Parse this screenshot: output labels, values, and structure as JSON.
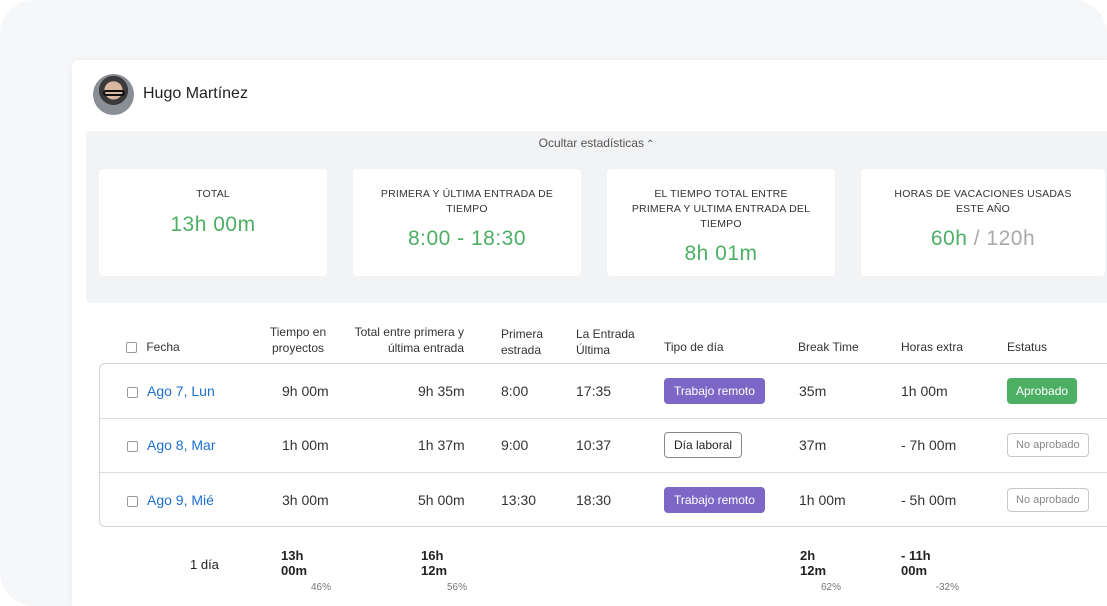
{
  "user": {
    "name": "Hugo Martínez"
  },
  "stats": {
    "toggle_label": "Ocultar estadísticas",
    "cards": [
      {
        "label": "TOTAL",
        "value": "13h 00m"
      },
      {
        "label": "PRIMERA Y ÚLTIMA ENTRADA DE TIEMPO",
        "value": "8:00 - 18:30"
      },
      {
        "label": "EL TIEMPO TOTAL ENTRE PRIMERA Y ULTIMA ENTRADA DEL TIEMPO",
        "value": "8h 01m"
      },
      {
        "label": "HORAS DE VACACIONES USADAS ESTE AÑO",
        "value": "60h",
        "value_total": "120h",
        "separator": "/"
      }
    ]
  },
  "table": {
    "headers": {
      "fecha": "Fecha",
      "tiempo_proyectos": "Tiempo en proyectos",
      "total_entre": "Total entre primera y última entrada",
      "primera": "Primera estrada",
      "ultima": "La Entrada Última",
      "tipo": "Tipo de día",
      "break": "Break Time",
      "extra": "Horas extra",
      "estatus": "Estatus"
    },
    "rows": [
      {
        "fecha": "Ago 7, Lun",
        "proyectos": "9h 00m",
        "total": "9h 35m",
        "primera": "8:00",
        "ultima": "17:35",
        "tipo": "Trabajo remoto",
        "break": "35m",
        "extra": "1h 00m",
        "estatus": "Aprobado"
      },
      {
        "fecha": "Ago 8, Mar",
        "proyectos": "1h 00m",
        "total": "1h 37m",
        "primera": "9:00",
        "ultima": "10:37",
        "tipo": "Día laboral",
        "break": "37m",
        "extra": "- 7h 00m",
        "estatus": "No aprobado"
      },
      {
        "fecha": "Ago 9, Mié",
        "proyectos": "3h 00m",
        "total": "5h 00m",
        "primera": "13:30",
        "ultima": "18:30",
        "tipo": "Trabajo remoto",
        "break": "1h 00m",
        "extra": "- 5h 00m",
        "estatus": "No aprobado"
      }
    ],
    "footer": {
      "days": "1 día",
      "proyectos": "13h 00m",
      "proyectos_pct": "46%",
      "total": "16h 12m",
      "total_pct": "56%",
      "break": "2h 12m",
      "break_pct": "62%",
      "extra": "- 11h 00m",
      "extra_pct": "-32%"
    }
  },
  "colors": {
    "accent_green": "#4caf64",
    "accent_purple": "#7c67c6",
    "link_blue": "#1e6fd0"
  }
}
